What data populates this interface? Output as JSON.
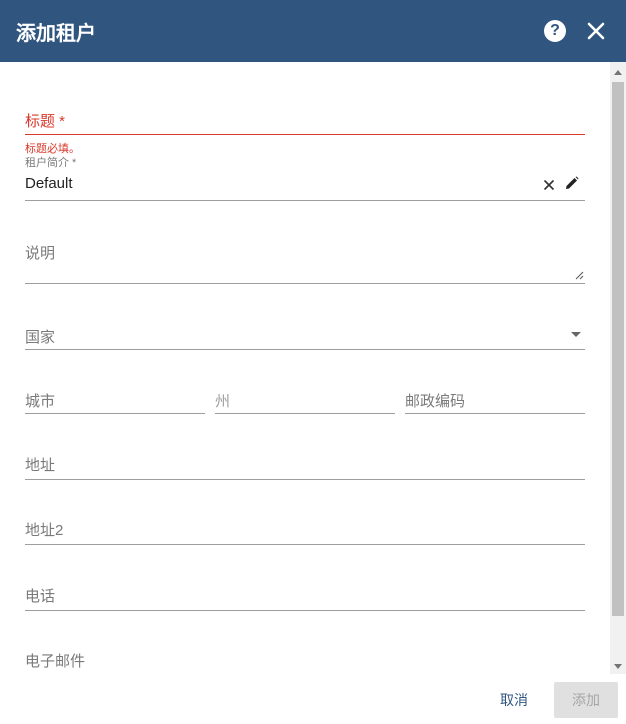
{
  "dialog": {
    "title": "添加租户",
    "help_icon": "help-circle-icon",
    "close_icon": "close-icon"
  },
  "form": {
    "title_label": "标题 *",
    "title_error": "标题必填。",
    "profile_label": "租户简介 *",
    "profile_value": "Default",
    "description_placeholder": "说明",
    "country_placeholder": "国家",
    "city_placeholder": "城市",
    "state_placeholder": "州",
    "zip_placeholder": "邮政编码",
    "address_placeholder": "地址",
    "address2_placeholder": "地址2",
    "phone_placeholder": "电话",
    "email_placeholder": "电子邮件"
  },
  "footer": {
    "cancel_label": "取消",
    "add_label": "添加"
  },
  "colors": {
    "header_bg": "#305680",
    "error": "#d9392b"
  }
}
